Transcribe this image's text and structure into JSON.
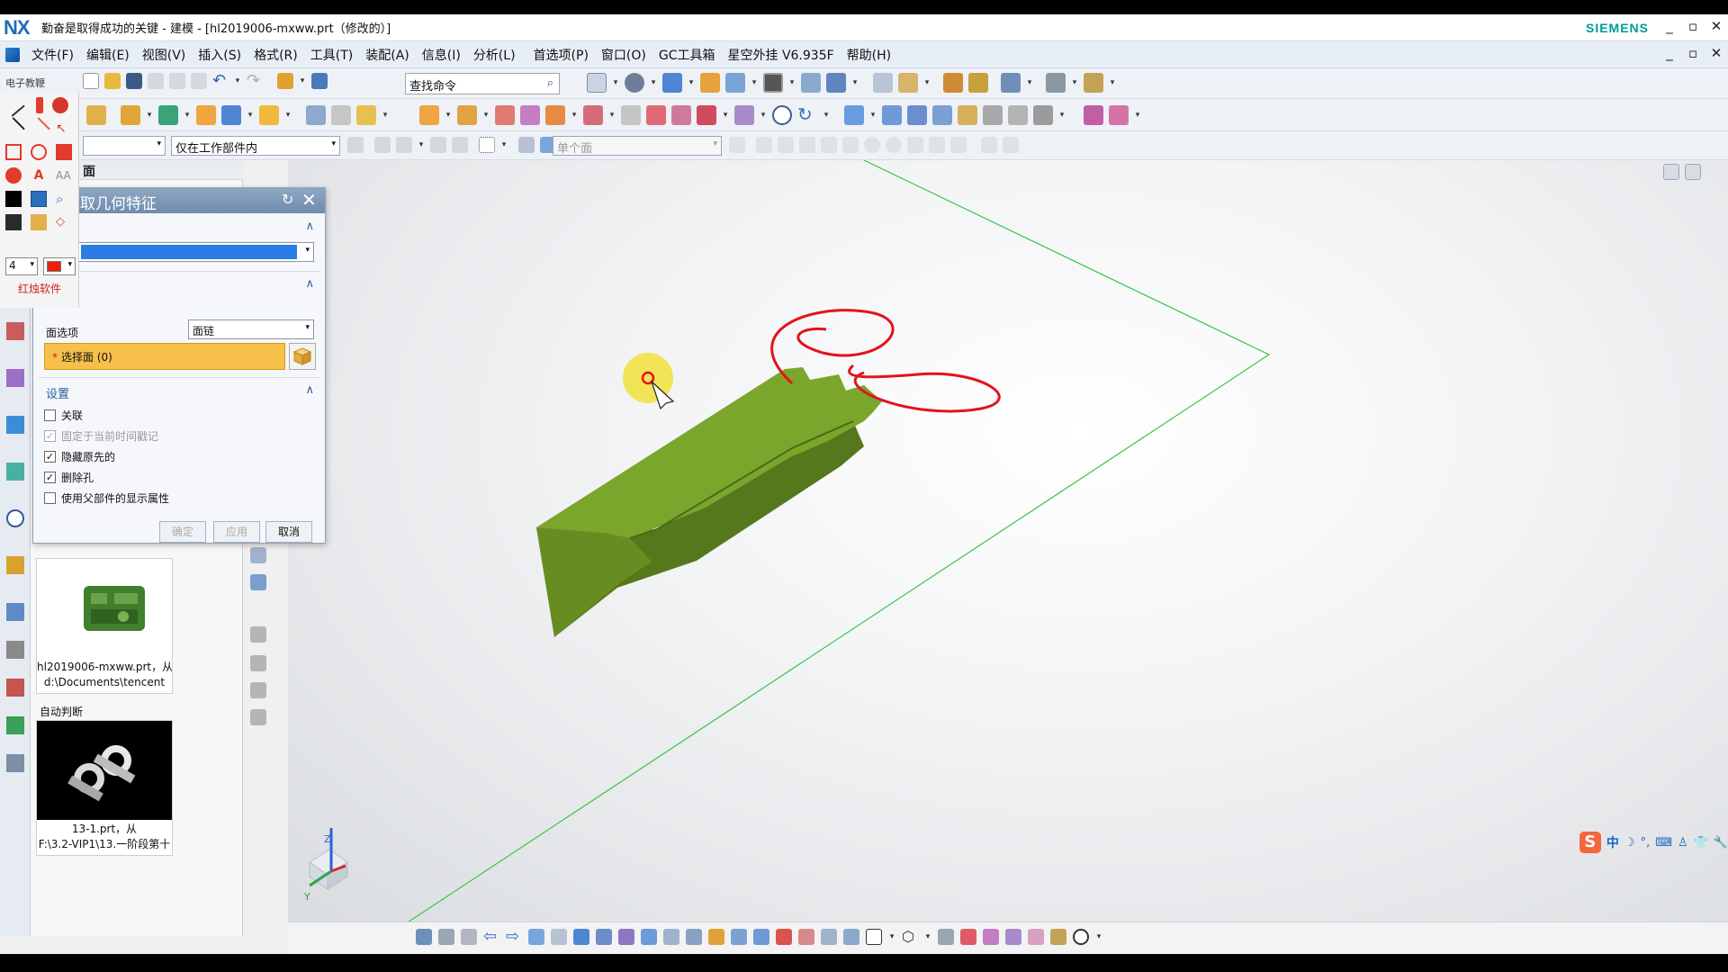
{
  "window": {
    "app_logo": "NX",
    "title": "勤奋是取得成功的关键 - 建模 - [hl2019006-mxww.prt（修改的）]",
    "brand": "SIEMENS",
    "controls": [
      "_",
      "▫",
      "✕"
    ]
  },
  "menu": {
    "items": [
      "文件(F)",
      "编辑(E)",
      "视图(V)",
      "插入(S)",
      "格式(R)",
      "工具(T)",
      "装配(A)",
      "信息(I)",
      "分析(L)",
      "首选项(P)",
      "窗口(O)",
      "GC工具箱",
      "星空外挂 V6.935F",
      "帮助(H)"
    ]
  },
  "toolbar": {
    "search_placeholder": "查找命令",
    "filter_scope": "仅在工作部件内",
    "selection_rule": "单个面"
  },
  "palette": {
    "label": "电子教鞭",
    "pen_size": "4",
    "pen_color": "#e8200c",
    "brand_label": "红烛软件"
  },
  "navigator": {
    "title": "面",
    "recent_parts": [
      {
        "caption_line1": "hl2019006-mxww.prt，从",
        "caption_line2": "d:\\Documents\\tencent"
      },
      {
        "caption_line1": "13-1.prt，从",
        "caption_line2": "F:\\3.2-VIP1\\13.一阶段第十"
      }
    ],
    "auto_label": "自动判断"
  },
  "dialog": {
    "title": "取几何特征",
    "type_section_label": "",
    "face_section": "面",
    "face_option_label": "面选项",
    "face_option_value": "面链",
    "select_face": "选择面 (0)",
    "settings_section": "设置",
    "checkboxes": [
      {
        "label": "关联",
        "checked": false,
        "disabled": false
      },
      {
        "label": "固定于当前时间戳记",
        "checked": true,
        "disabled": true
      },
      {
        "label": "隐藏原先的",
        "checked": true,
        "disabled": false
      },
      {
        "label": "删除孔",
        "checked": true,
        "disabled": false
      },
      {
        "label": "使用父部件的显示属性",
        "checked": false,
        "disabled": false
      }
    ],
    "ok": "确定",
    "apply": "应用",
    "cancel": "取消"
  },
  "viewport": {
    "axis_z": "Z",
    "axis_y": "Y",
    "model_color": "#6f9a22",
    "annotation_color": "#e3131b",
    "grid_color": "#33c64a"
  },
  "ime": {
    "logo": "S",
    "lang": "中",
    "symbols": [
      "☽",
      "°,",
      "⌨",
      "♙",
      "👕",
      "🔧"
    ]
  }
}
